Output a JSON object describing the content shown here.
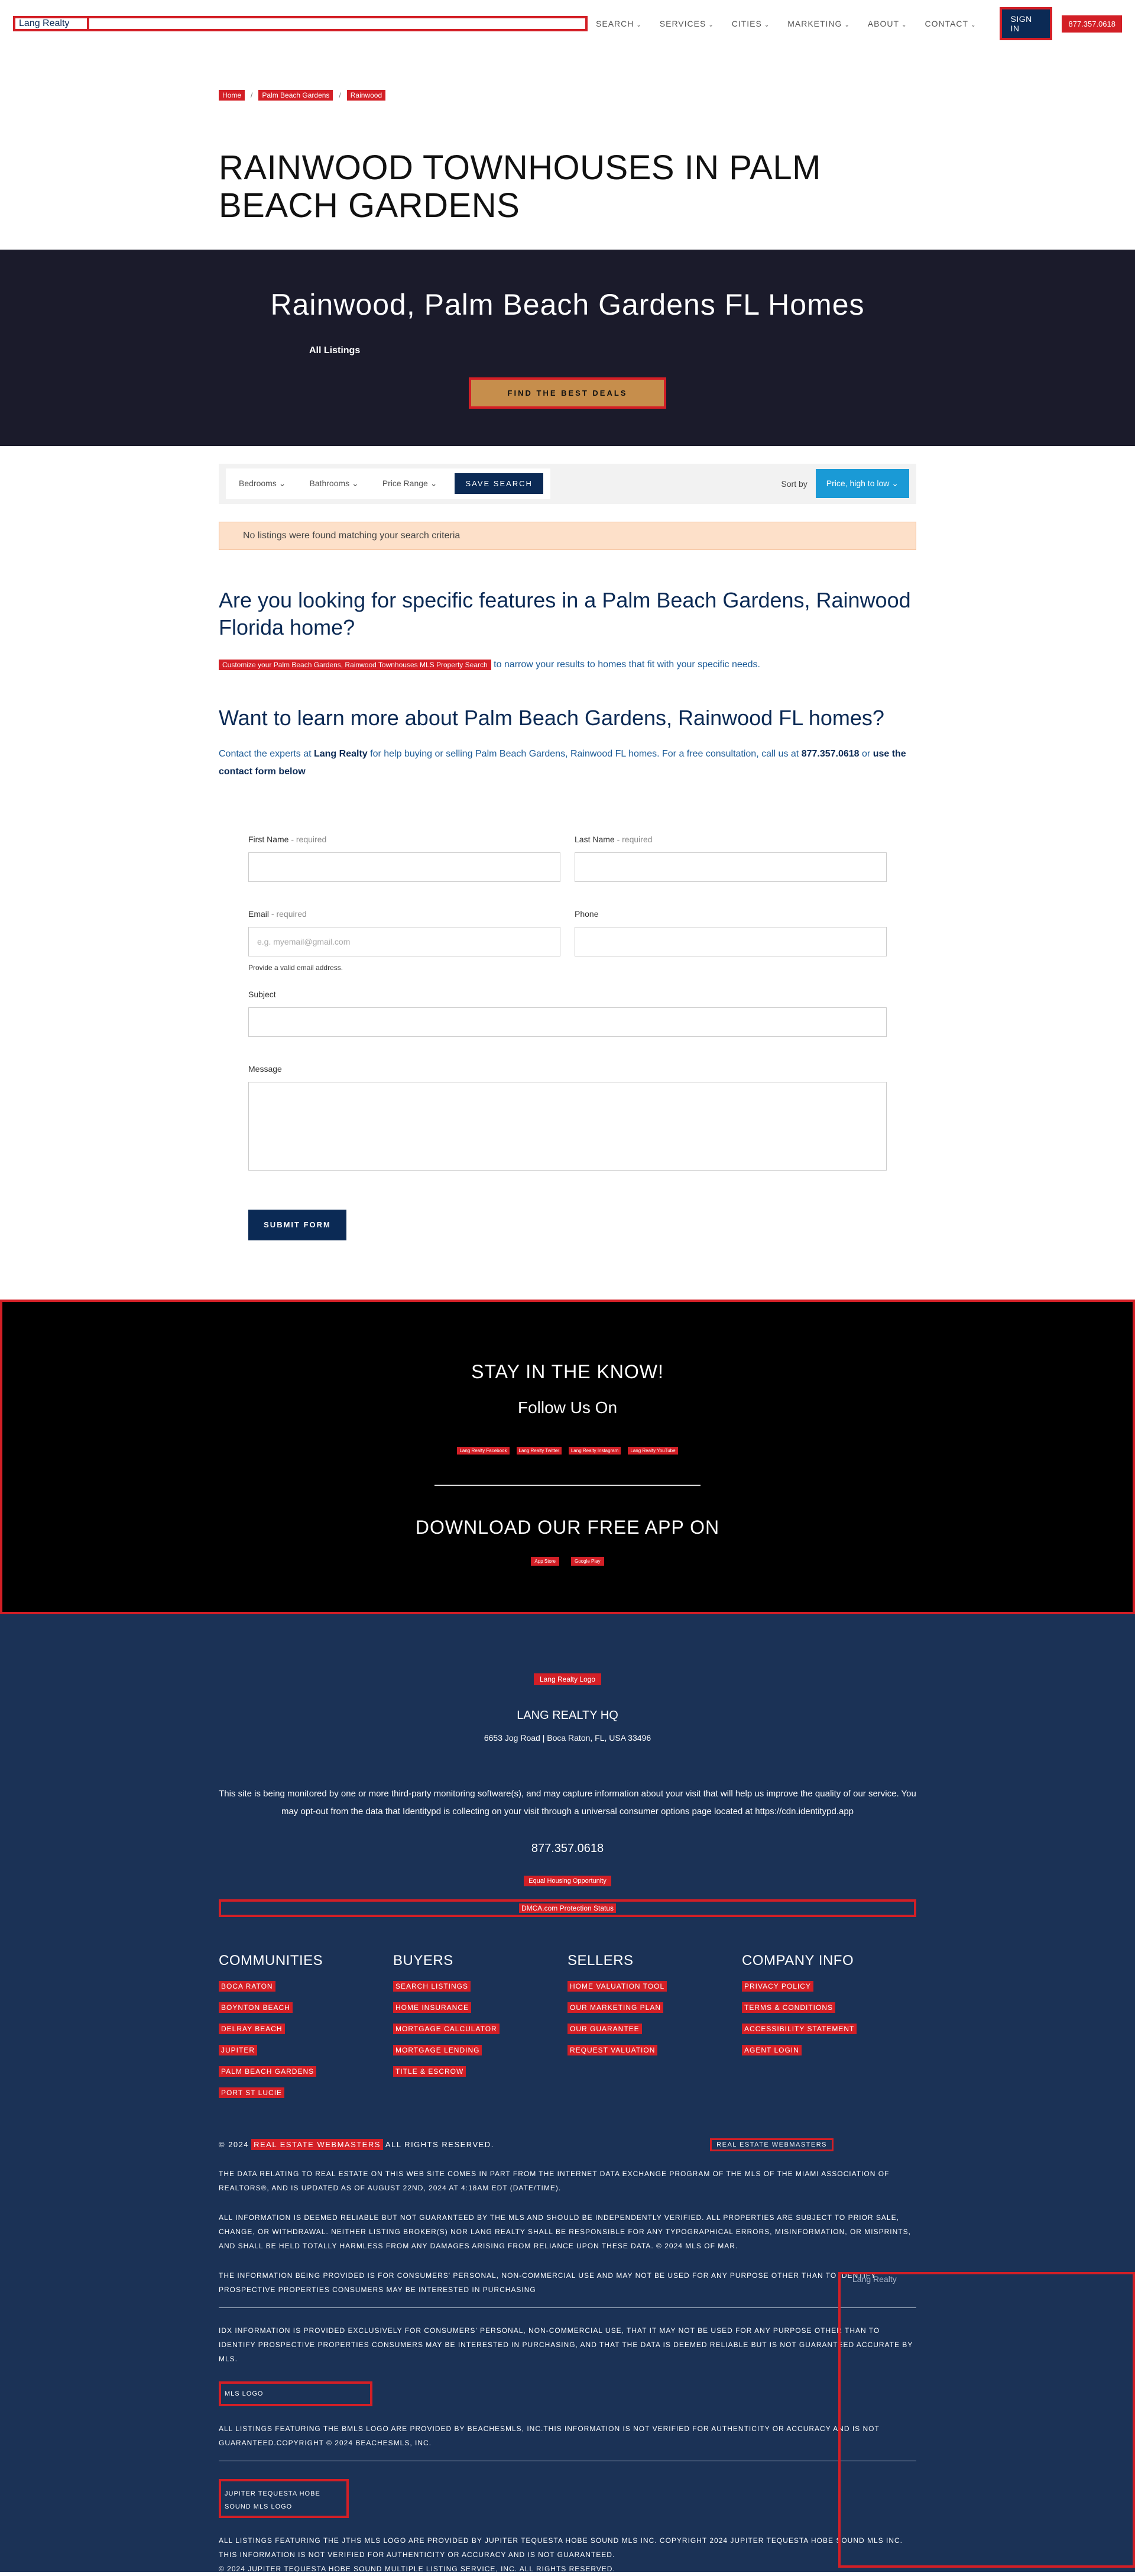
{
  "header": {
    "logo_text": "Lang Realty",
    "nav": [
      "SEARCH",
      "SERVICES",
      "CITIES",
      "MARKETING",
      "ABOUT",
      "CONTACT"
    ],
    "signin": "SIGN IN",
    "phone": "877.357.0618"
  },
  "breadcrumb": [
    "Home",
    "Palm Beach Gardens",
    "Rainwood"
  ],
  "page_title": "RAINWOOD TOWNHOUSES IN PALM BEACH GARDENS",
  "hero": {
    "title": "Rainwood, Palm Beach Gardens FL Homes",
    "tab": "All Listings",
    "button": "FIND THE BEST DEALS"
  },
  "filters": {
    "bedrooms": "Bedrooms",
    "bathrooms": "Bathrooms",
    "price": "Price Range",
    "save": "SAVE SEARCH",
    "sort_label": "Sort by",
    "sort_value": "Price, high to low"
  },
  "alert": "No listings were found matching your search criteria",
  "features": {
    "heading": "Are you looking for specific features in a Palm Beach Gardens, Rainwood Florida home?",
    "link": "Customize your Palm Beach Gardens, Rainwood Townhouses MLS Property Search",
    "rest": " to narrow your results to homes that fit with your specific needs."
  },
  "learn": {
    "heading": "Want to learn more about Palm Beach Gardens, Rainwood FL homes?",
    "p1": "Contact the experts at ",
    "brand": "Lang Realty",
    "p2": " for help buying or selling Palm Beach Gardens, Rainwood FL homes. For a free consultation, call us at ",
    "phone": "877.357.0618",
    "p3": " or ",
    "form_link": "use the contact form below"
  },
  "form": {
    "first_name": "First Name",
    "last_name": "Last Name",
    "required": " - required",
    "email": "Email",
    "email_placeholder": "e.g. myemail@gmail.com",
    "email_hint": "Provide a valid email address.",
    "phone": "Phone",
    "subject": "Subject",
    "message": "Message",
    "submit": "SUBMIT FORM"
  },
  "stay": {
    "title": "STAY IN THE KNOW!",
    "follow": "Follow Us On",
    "social": [
      "Lang Realty Facebook",
      "Lang Realty Twitter",
      "Lang Realty Instagram",
      "Lang Realty YouTube"
    ],
    "download": "DOWNLOAD OUR FREE APP ON",
    "apps": [
      "App Store",
      "Google Play"
    ]
  },
  "footer": {
    "logo": "Lang Realty Logo",
    "hq": "LANG REALTY HQ",
    "address": "6653 Jog Road | Boca Raton, FL, USA 33496",
    "monitor": "This site is being monitored by one or more third-party monitoring software(s), and may capture information about your visit that will help us improve the quality of our service. You may opt-out from the data that Identitypd is collecting on your visit through a universal consumer options page located at https://cdn.identitypd.app",
    "phone": "877.357.0618",
    "fair_housing": "Equal Housing Opportunity",
    "dmca": "DMCA.com Protection Status",
    "columns": [
      {
        "title": "COMMUNITIES",
        "links": [
          "BOCA RATON",
          "BOYNTON BEACH",
          "DELRAY BEACH",
          "JUPITER",
          "PALM BEACH GARDENS",
          "PORT ST LUCIE"
        ]
      },
      {
        "title": "BUYERS",
        "links": [
          "SEARCH LISTINGS",
          "HOME INSURANCE",
          "MORTGAGE CALCULATOR",
          "MORTGAGE LENDING",
          "TITLE & ESCROW"
        ]
      },
      {
        "title": "SELLERS",
        "links": [
          "HOME VALUATION TOOL",
          "OUR MARKETING PLAN",
          "OUR GUARANTEE",
          "REQUEST VALUATION"
        ]
      },
      {
        "title": "COMPANY INFO",
        "links": [
          "PRIVACY POLICY",
          "TERMS & CONDITIONS",
          "ACCESSIBILITY STATEMENT",
          "AGENT LOGIN"
        ]
      }
    ],
    "copy_prefix": "© 2024",
    "copy_link": "REAL ESTATE WEBMASTERS",
    "copy_suffix": "ALL RIGHTS RESERVED.",
    "rew_badge": "REAL ESTATE WEBMASTERS",
    "legal1": "THE DATA RELATING TO REAL ESTATE ON THIS WEB SITE COMES IN PART FROM THE INTERNET DATA EXCHANGE PROGRAM OF THE MLS OF THE MIAMI ASSOCIATION OF REALTORS®, AND IS UPDATED AS OF AUGUST 22ND, 2024 AT 4:18AM EDT (DATE/TIME).",
    "legal2": "ALL INFORMATION IS DEEMED RELIABLE BUT NOT GUARANTEED BY THE MLS AND SHOULD BE INDEPENDENTLY VERIFIED. ALL PROPERTIES ARE SUBJECT TO PRIOR SALE, CHANGE, OR WITHDRAWAL. NEITHER LISTING BROKER(S) NOR LANG REALTY SHALL BE RESPONSIBLE FOR ANY TYPOGRAPHICAL ERRORS, MISINFORMATION, OR MISPRINTS, AND SHALL BE HELD TOTALLY HARMLESS FROM ANY DAMAGES ARISING FROM RELIANCE UPON THESE DATA. © 2024 MLS OF MAR.",
    "legal3": "THE INFORMATION BEING PROVIDED IS FOR CONSUMERS' PERSONAL, NON-COMMERCIAL USE AND MAY NOT BE USED FOR ANY PURPOSE OTHER THAN TO IDENTIFY PROSPECTIVE PROPERTIES CONSUMERS MAY BE INTERESTED IN PURCHASING",
    "legal4": "IDX INFORMATION IS PROVIDED EXCLUSIVELY FOR CONSUMERS' PERSONAL, NON-COMMERCIAL USE, THAT IT MAY NOT BE USED FOR ANY PURPOSE OTHER THAN TO IDENTIFY PROSPECTIVE PROPERTIES CONSUMERS MAY BE INTERESTED IN PURCHASING, AND THAT THE DATA IS DEEMED RELIABLE BUT IS NOT GUARANTEED ACCURATE BY MLS.",
    "mls_logo": "MLS LOGO",
    "legal5": "ALL LISTINGS FEATURING THE BMLS LOGO ARE PROVIDED BY BEACHESMLS, INC.THIS INFORMATION IS NOT VERIFIED FOR AUTHENTICITY OR ACCURACY AND IS NOT GUARANTEED.COPYRIGHT © 2024 BEACHESMLS, INC.",
    "jt_logo_1": "JUPITER TEQUESTA HOBE",
    "jt_logo_2": "SOUND MLS LOGO",
    "legal6": "ALL LISTINGS FEATURING THE JTHS MLS LOGO ARE PROVIDED BY JUPITER TEQUESTA HOBE SOUND MLS INC. COPYRIGHT 2024 JUPITER TEQUESTA HOBE SOUND MLS INC. THIS INFORMATION IS NOT VERIFIED FOR AUTHENTICITY OR ACCURACY AND IS NOT GUARANTEED.",
    "legal7": "© 2024 JUPITER TEQUESTA HOBE SOUND MULTIPLE LISTING SERVICE, INC. ALL RIGHTS RESERVED.",
    "side_label": "Lang Realty"
  }
}
